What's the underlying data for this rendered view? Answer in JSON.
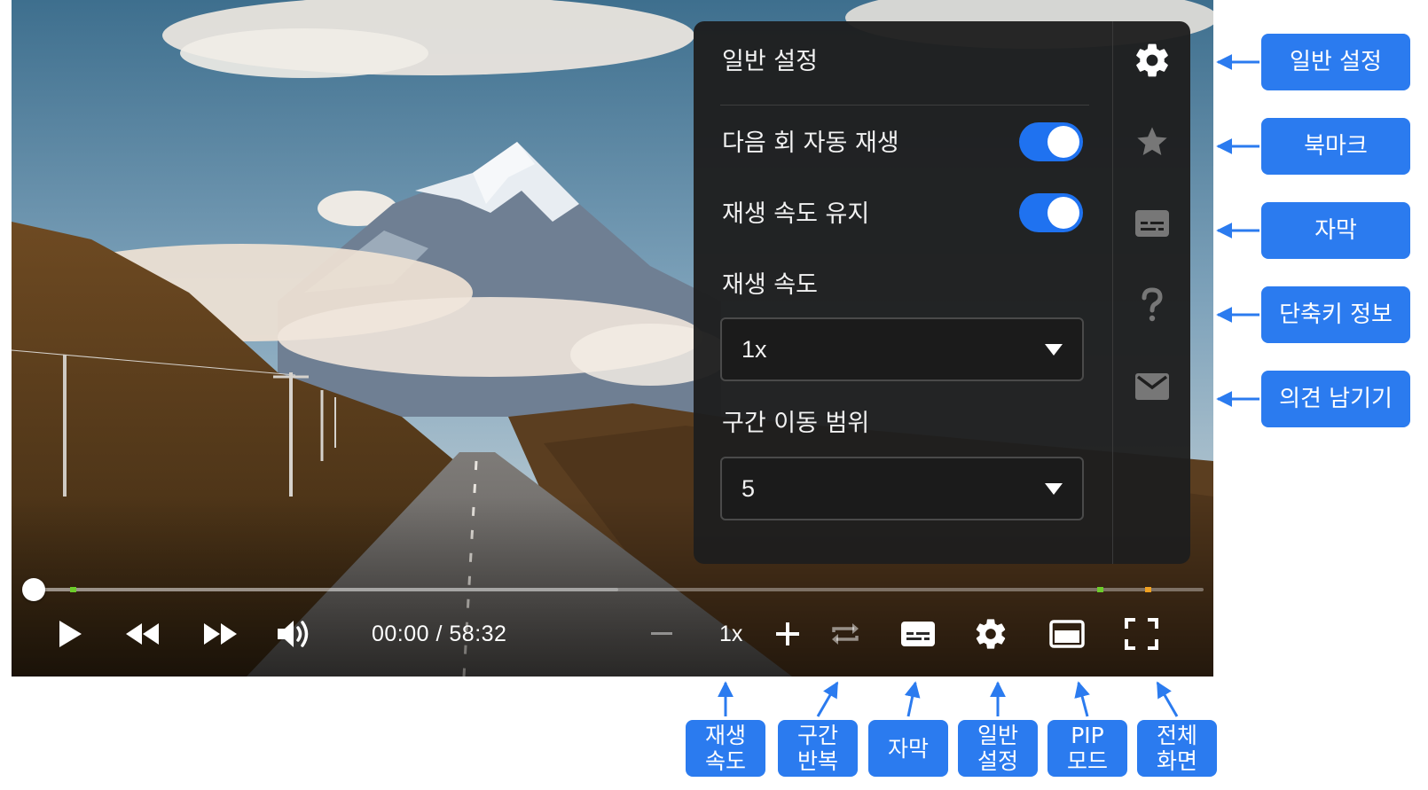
{
  "player": {
    "time_display": "00:00 / 58:32",
    "progress": 0.0,
    "buffered": 0.5,
    "speed_value": "1x",
    "controls": {
      "play": "play-icon",
      "rewind": "rewind-icon",
      "fast_forward": "fast-forward-icon",
      "volume": "volume-icon",
      "speed_decrease": "minus-icon",
      "speed_increase": "plus-icon",
      "repeat": "repeat-icon",
      "subtitles": "subtitles-icon",
      "settings": "gear-icon",
      "pip": "pip-icon",
      "fullscreen": "fullscreen-icon"
    },
    "marker_colors": [
      "#6ccc2a",
      "#6ccc2a",
      "#f0a020"
    ]
  },
  "settings_panel": {
    "title": "일반 설정",
    "autoplay_label": "다음 회 자동 재생",
    "autoplay_on": true,
    "keep_speed_label": "재생 속도 유지",
    "keep_speed_on": true,
    "speed_label": "재생 속도",
    "speed_selected": "1x",
    "seek_range_label": "구간 이동 범위",
    "seek_range_selected": "5",
    "toggle_color": "#1f72f0",
    "sidebar": [
      "gear-icon",
      "star-icon",
      "subtitles-icon",
      "question-icon",
      "mail-icon"
    ]
  },
  "callouts_right": [
    {
      "label": "일반 설정"
    },
    {
      "label": "북마크"
    },
    {
      "label": "자막"
    },
    {
      "label": "단축키 정보"
    },
    {
      "label": "의견 남기기"
    }
  ],
  "callouts_bottom": [
    {
      "label": "재생\n속도"
    },
    {
      "label": "구간\n반복"
    },
    {
      "label": "자막"
    },
    {
      "label": "일반\n설정"
    },
    {
      "label": "PIP\n모드"
    },
    {
      "label": "전체\n화면"
    }
  ],
  "colors": {
    "callout": "#2b7bef",
    "panel_bg": "#1e1e1e"
  }
}
